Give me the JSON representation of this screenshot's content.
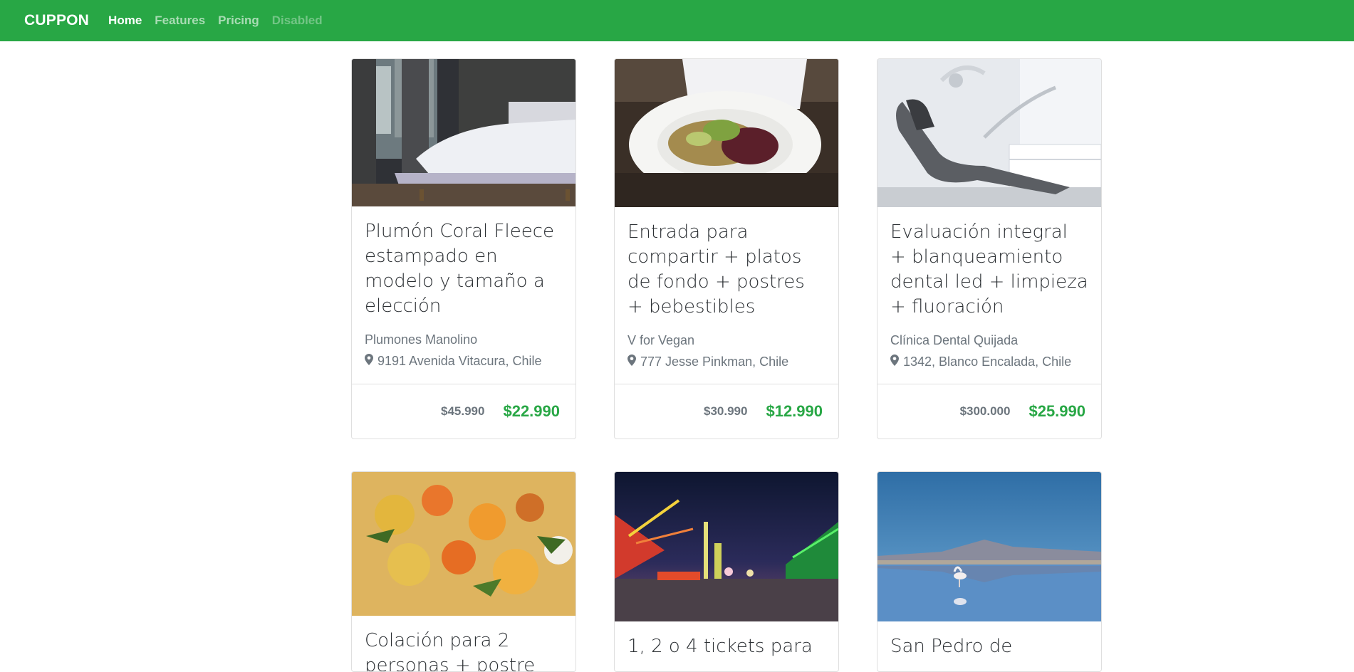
{
  "navbar": {
    "brand": "CUPPON",
    "links": [
      {
        "label": "Home",
        "state": "active"
      },
      {
        "label": "Features",
        "state": "normal"
      },
      {
        "label": "Pricing",
        "state": "normal"
      },
      {
        "label": "Disabled",
        "state": "disabled"
      }
    ]
  },
  "deals": [
    {
      "title": "Plumón Coral Fleece estampado en modelo y tamaño a elección",
      "merchant": "Plumones Manolino",
      "address": "9191 Avenida Vitacura, Chile",
      "old_price": "$45.990",
      "new_price": "$22.990",
      "image": "bedroom-photo"
    },
    {
      "title": "Entrada para compartir + platos de fondo + postres + bebestibles",
      "merchant": "V for Vegan",
      "address": "777 Jesse Pinkman, Chile",
      "old_price": "$30.990",
      "new_price": "$12.990",
      "image": "salad-plate-photo"
    },
    {
      "title": "Evaluación integral + blanqueamiento dental led + limpieza + fluoración",
      "merchant": "Clínica Dental Quijada",
      "address": "1342, Blanco Encalada, Chile",
      "old_price": "$300.000",
      "new_price": "$25.990",
      "image": "dental-chair-photo"
    },
    {
      "title": "Colación para 2 personas + postre",
      "image": "food-dish-photo"
    },
    {
      "title": "1, 2 o 4 tickets para",
      "image": "amusement-park-photo"
    },
    {
      "title": "San Pedro de",
      "image": "salt-flat-flamingo-photo"
    }
  ],
  "colors": {
    "accent": "#28a745",
    "muted": "#6c757d"
  },
  "icons": {
    "address": "map-marker-icon"
  }
}
